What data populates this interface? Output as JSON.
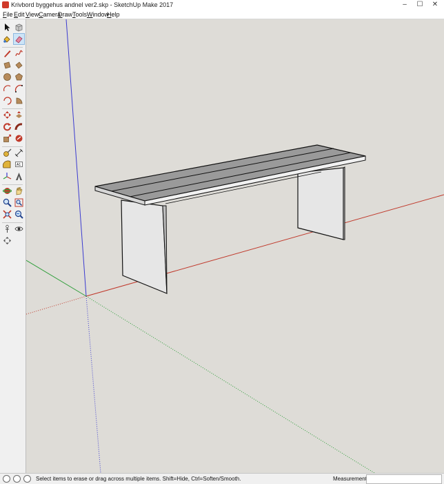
{
  "window": {
    "title": "Krivbord byggehus andnel ver2.skp - SketchUp Make 2017",
    "controls": [
      "–",
      "☐",
      "✕"
    ]
  },
  "menu": {
    "items": [
      {
        "mnemonic": "F",
        "rest": "ile"
      },
      {
        "mnemonic": "E",
        "rest": "dit"
      },
      {
        "mnemonic": "V",
        "rest": "iew"
      },
      {
        "mnemonic": "C",
        "rest": "amera"
      },
      {
        "mnemonic": "D",
        "rest": "raw"
      },
      {
        "mnemonic": "T",
        "rest": "ools"
      },
      {
        "mnemonic": "W",
        "rest": "indow"
      },
      {
        "mnemonic": "H",
        "rest": "elp"
      }
    ]
  },
  "toolbar": {
    "tools": [
      {
        "name": "select",
        "icon": "select-arrow-icon"
      },
      {
        "name": "make-component",
        "icon": "component-icon"
      },
      {
        "name": "paint-bucket",
        "icon": "paint-bucket-icon"
      },
      {
        "name": "eraser",
        "icon": "eraser-icon",
        "active": true
      },
      {
        "name": "line",
        "icon": "pencil-icon"
      },
      {
        "name": "freehand",
        "icon": "freehand-icon"
      },
      {
        "name": "rectangle",
        "icon": "rectangle-icon"
      },
      {
        "name": "rotated-rectangle",
        "icon": "rotated-rectangle-icon"
      },
      {
        "name": "circle",
        "icon": "circle-icon"
      },
      {
        "name": "polygon",
        "icon": "polygon-icon"
      },
      {
        "name": "arc",
        "icon": "arc-icon"
      },
      {
        "name": "two-point-arc",
        "icon": "two-point-arc-icon"
      },
      {
        "name": "three-point-arc",
        "icon": "three-point-arc-icon"
      },
      {
        "name": "pie",
        "icon": "pie-icon"
      },
      {
        "name": "move",
        "icon": "move-icon"
      },
      {
        "name": "push-pull",
        "icon": "push-pull-icon"
      },
      {
        "name": "rotate",
        "icon": "rotate-icon"
      },
      {
        "name": "follow-me",
        "icon": "follow-me-icon"
      },
      {
        "name": "scale",
        "icon": "scale-icon"
      },
      {
        "name": "offset",
        "icon": "offset-icon"
      },
      {
        "name": "tape-measure",
        "icon": "tape-measure-icon"
      },
      {
        "name": "dimension",
        "icon": "dimension-icon"
      },
      {
        "name": "protractor",
        "icon": "protractor-icon"
      },
      {
        "name": "text",
        "icon": "text-icon"
      },
      {
        "name": "axes",
        "icon": "axes-icon"
      },
      {
        "name": "3d-text",
        "icon": "3d-text-icon"
      },
      {
        "name": "orbit",
        "icon": "orbit-icon"
      },
      {
        "name": "pan",
        "icon": "pan-hand-icon"
      },
      {
        "name": "zoom",
        "icon": "zoom-icon"
      },
      {
        "name": "zoom-window",
        "icon": "zoom-window-icon"
      },
      {
        "name": "zoom-extents",
        "icon": "zoom-extents-icon"
      },
      {
        "name": "previous-view",
        "icon": "previous-view-icon"
      },
      {
        "name": "position-camera",
        "icon": "position-camera-icon"
      },
      {
        "name": "look-around",
        "icon": "look-around-icon"
      },
      {
        "name": "walk",
        "icon": "walk-icon"
      }
    ]
  },
  "viewport": {
    "background": "#dedcd7",
    "axis_colors": {
      "red": "#c0392b",
      "green": "#2e9e3a",
      "blue": "#3a3ad0"
    },
    "model": {
      "name": "bench",
      "plank_count": 3
    }
  },
  "status": {
    "message": "Select items to erase or drag across multiple items. Shift=Hide, Ctrl=Soften/Smooth.",
    "measurements_label": "Measurements",
    "measurements_value": ""
  }
}
